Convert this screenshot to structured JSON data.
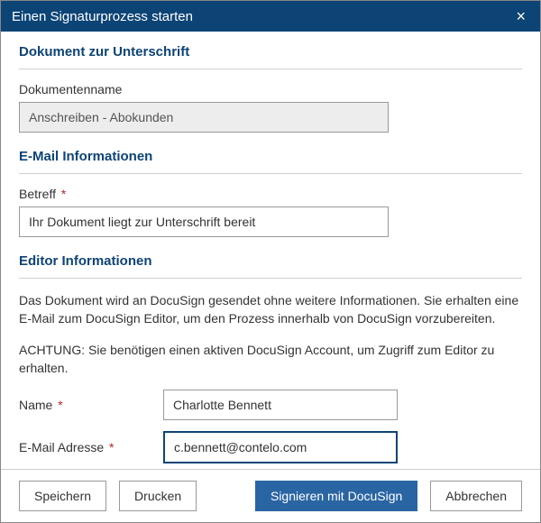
{
  "dialog": {
    "title": "Einen Signaturprozess starten",
    "close_label": "×"
  },
  "section_document": {
    "heading": "Dokument zur Unterschrift",
    "name_label": "Dokumentenname",
    "name_value": "Anschreiben - Abokunden"
  },
  "section_email": {
    "heading": "E-Mail Informationen",
    "subject_label": "Betreff",
    "subject_value": "Ihr Dokument liegt zur Unterschrift bereit"
  },
  "section_editor": {
    "heading": "Editor Informationen",
    "info_text": "Das Dokument wird an DocuSign gesendet ohne weitere Informationen. Sie erhalten eine E-Mail zum DocuSign Editor, um den Prozess innerhalb von DocuSign vorzubereiten.",
    "warning_text": "ACHTUNG: Sie benötigen einen aktiven DocuSign Account, um Zugriff zum Editor zu erhalten.",
    "name_label": "Name",
    "name_value": "Charlotte Bennett",
    "email_label": "E-Mail Adresse",
    "email_value": "c.bennett@contelo.com"
  },
  "required_marker": "*",
  "footer": {
    "save": "Speichern",
    "print": "Drucken",
    "sign": "Signieren mit DocuSign",
    "cancel": "Abbrechen"
  }
}
